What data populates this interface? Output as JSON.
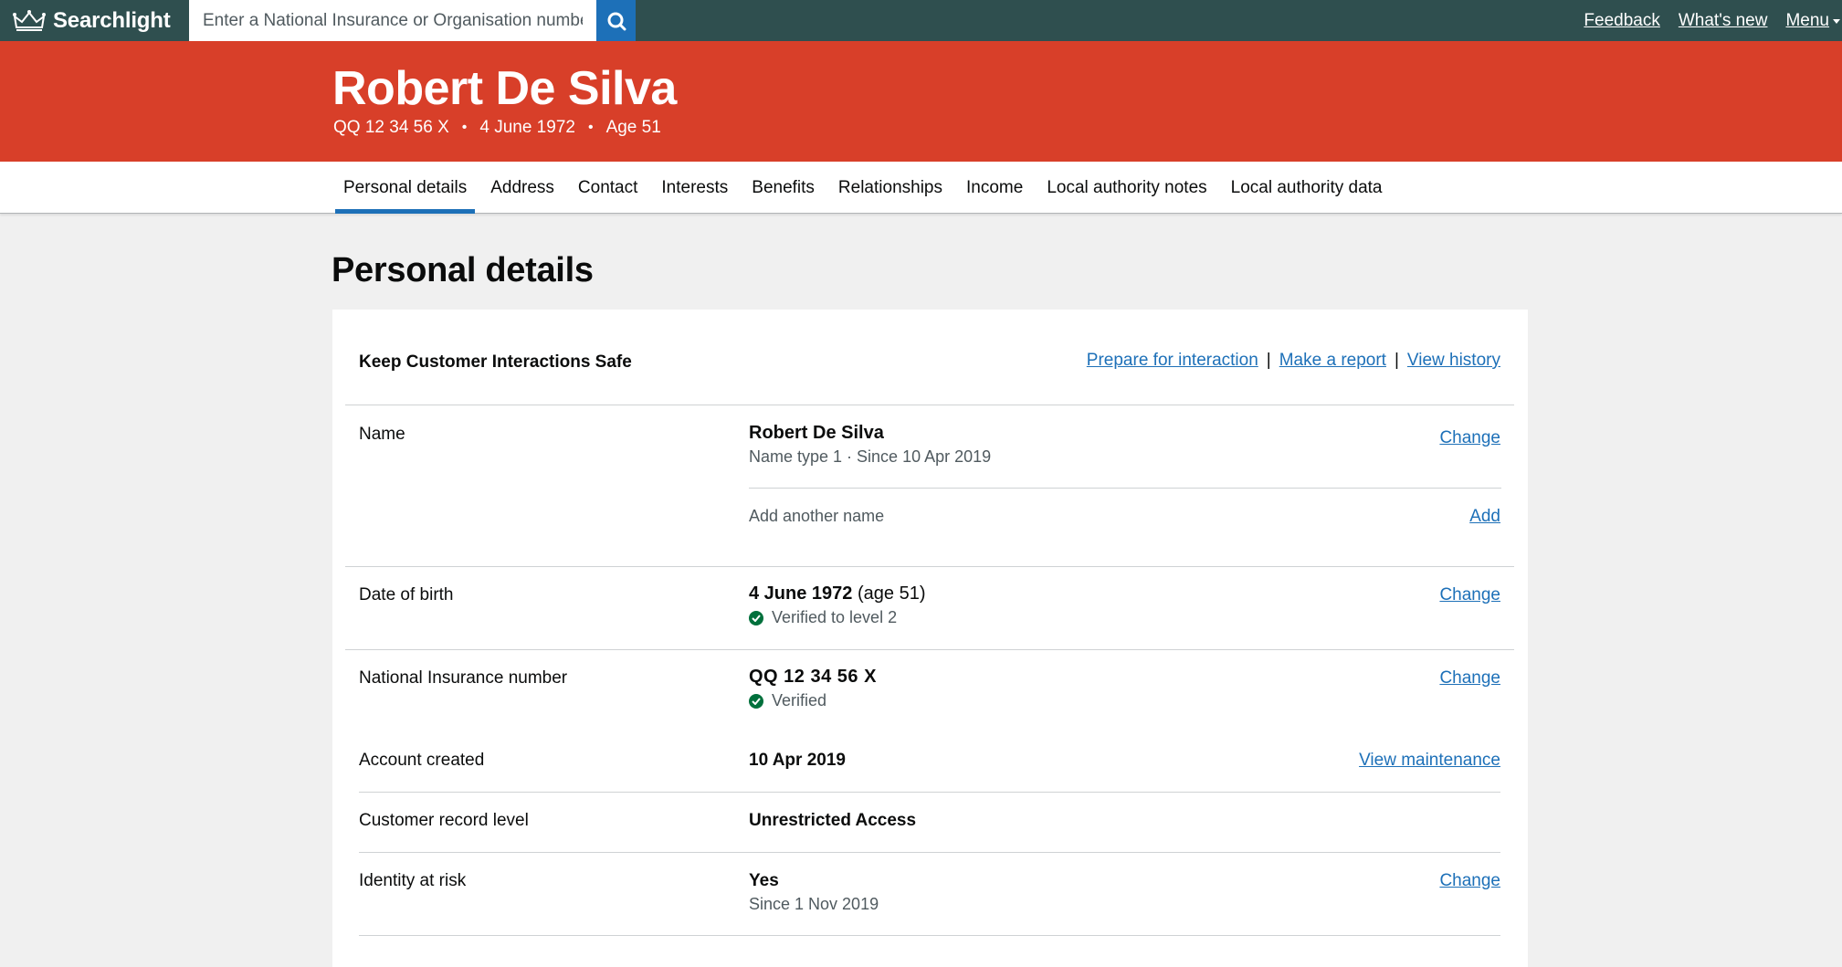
{
  "brand": {
    "name": "Searchlight",
    "icon": "crown-icon"
  },
  "search": {
    "placeholder": "Enter a National Insurance or Organisation number",
    "icon": "search-icon"
  },
  "top_links": {
    "feedback": "Feedback",
    "whats_new": "What's new",
    "menu": "Menu"
  },
  "person": {
    "name": "Robert De Silva",
    "nino": "QQ 12 34 56 X",
    "dob": "4 June 1972",
    "age": "Age 51",
    "separator": "•"
  },
  "tabs": [
    {
      "label": "Personal details",
      "active": true
    },
    {
      "label": "Address"
    },
    {
      "label": "Contact"
    },
    {
      "label": "Interests"
    },
    {
      "label": "Benefits"
    },
    {
      "label": "Relationships"
    },
    {
      "label": "Income"
    },
    {
      "label": "Local authority notes"
    },
    {
      "label": "Local authority data"
    }
  ],
  "main": {
    "title": "Personal details",
    "card": {
      "title": "Keep Customer Interactions Safe",
      "actions": [
        "Prepare for interaction",
        "Make a report",
        "View history"
      ],
      "action_separator": "|"
    },
    "rows": {
      "name": {
        "label": "Name",
        "value": "Robert De Silva",
        "sub": "Name type 1 · Since 10 Apr 2019",
        "action": "Change",
        "add_text": "Add another name",
        "add_action": "Add"
      },
      "dob": {
        "label": "Date of birth",
        "value": "4 June 1972",
        "value_extra": "(age 51)",
        "sub": "Verified to level 2",
        "action": "Change"
      },
      "nino": {
        "label": "National Insurance number",
        "value": "QQ 12 34 56 X",
        "sub": "Verified",
        "action": "Change"
      },
      "account_created": {
        "label": "Account created",
        "value": "10 Apr 2019",
        "action": "View maintenance"
      },
      "record_level": {
        "label": "Customer record level",
        "value": "Unrestricted Access"
      },
      "identity_risk": {
        "label": "Identity at risk",
        "value": "Yes",
        "sub": "Since 1 Nov 2019",
        "action": "Change"
      }
    }
  },
  "colors": {
    "topbar": "#2f4f4f",
    "header": "#d83f29",
    "link": "#1d70b8",
    "verified": "#00703c",
    "page_bg": "#f0f0f0"
  }
}
